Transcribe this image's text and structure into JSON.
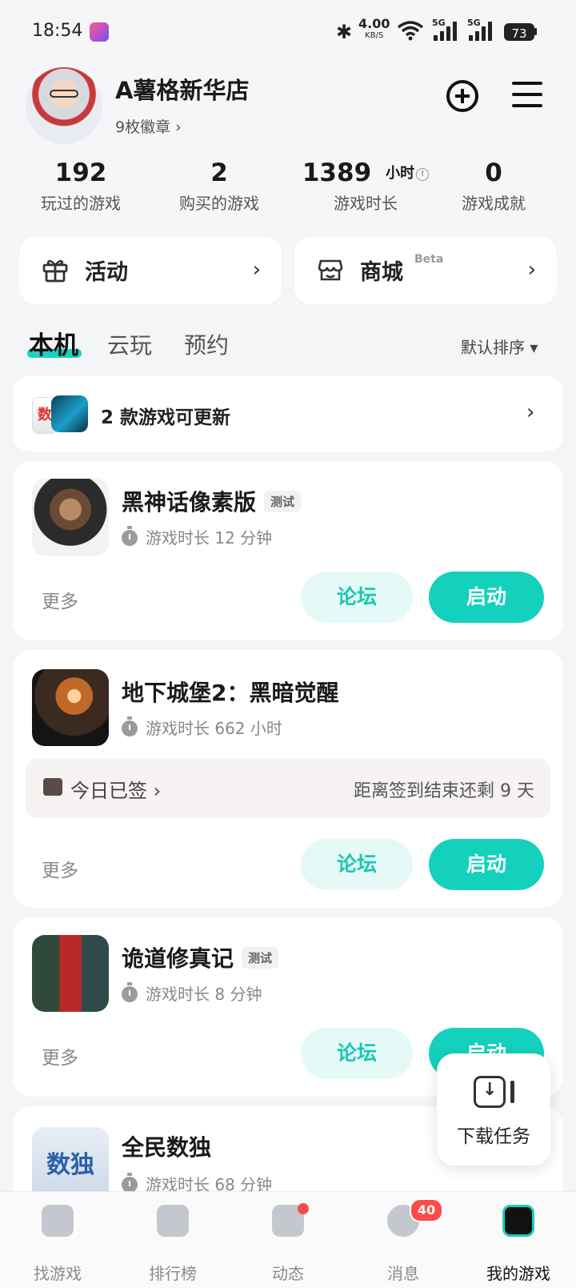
{
  "status_bar": {
    "time": "18:54",
    "net_speed": "4.00",
    "net_speed_unit": "KB/S",
    "signal_1": "5G",
    "signal_2": "5G",
    "battery": "73"
  },
  "profile": {
    "username": "A薯格新华店",
    "badges": "9枚徽章 ›"
  },
  "stats": [
    {
      "value": "192",
      "label": "玩过的游戏"
    },
    {
      "value": "2",
      "label": "购买的游戏"
    },
    {
      "value": "1389",
      "unit": "小时",
      "label": "游戏时长"
    },
    {
      "value": "0",
      "label": "游戏成就"
    }
  ],
  "quick_links": [
    {
      "label": "活动",
      "icon": "gift-icon"
    },
    {
      "label": "商城",
      "tag": "Beta",
      "icon": "store-icon"
    }
  ],
  "tabs": [
    "本机",
    "云玩",
    "预约"
  ],
  "sort_label": "默认排序 ▾",
  "update_banner": {
    "text": "2 款游戏可更新"
  },
  "games": [
    {
      "title": "黑神话像素版",
      "tag": "测试",
      "playtime": "游戏时长 12 分钟",
      "more": "更多",
      "forum": "论坛",
      "launch": "启动"
    },
    {
      "title": "地下城堡2：黑暗觉醒",
      "playtime": "游戏时长 662 小时",
      "checkin": "今日已签 ›",
      "checkin_remaining": "距离签到结束还剩 9 天",
      "more": "更多",
      "forum": "论坛",
      "launch": "启动"
    },
    {
      "title": "诡道修真记",
      "tag": "测试",
      "playtime": "游戏时长 8 分钟",
      "more": "更多",
      "forum": "论坛",
      "launch": "启动"
    },
    {
      "title": "全民数独",
      "playtime": "游戏时长 68 分钟"
    }
  ],
  "download_task": {
    "label": "下载任务"
  },
  "bottom_nav": [
    {
      "label": "找游戏",
      "icon": "find-games-icon"
    },
    {
      "label": "排行榜",
      "icon": "ranking-icon"
    },
    {
      "label": "动态",
      "icon": "feed-icon"
    },
    {
      "label": "消息",
      "icon": "message-icon",
      "badge": "40"
    },
    {
      "label": "我的游戏",
      "icon": "my-games-icon",
      "active": true
    }
  ],
  "colors": {
    "accent": "#13d1bd",
    "badge": "#ff4a4a"
  }
}
